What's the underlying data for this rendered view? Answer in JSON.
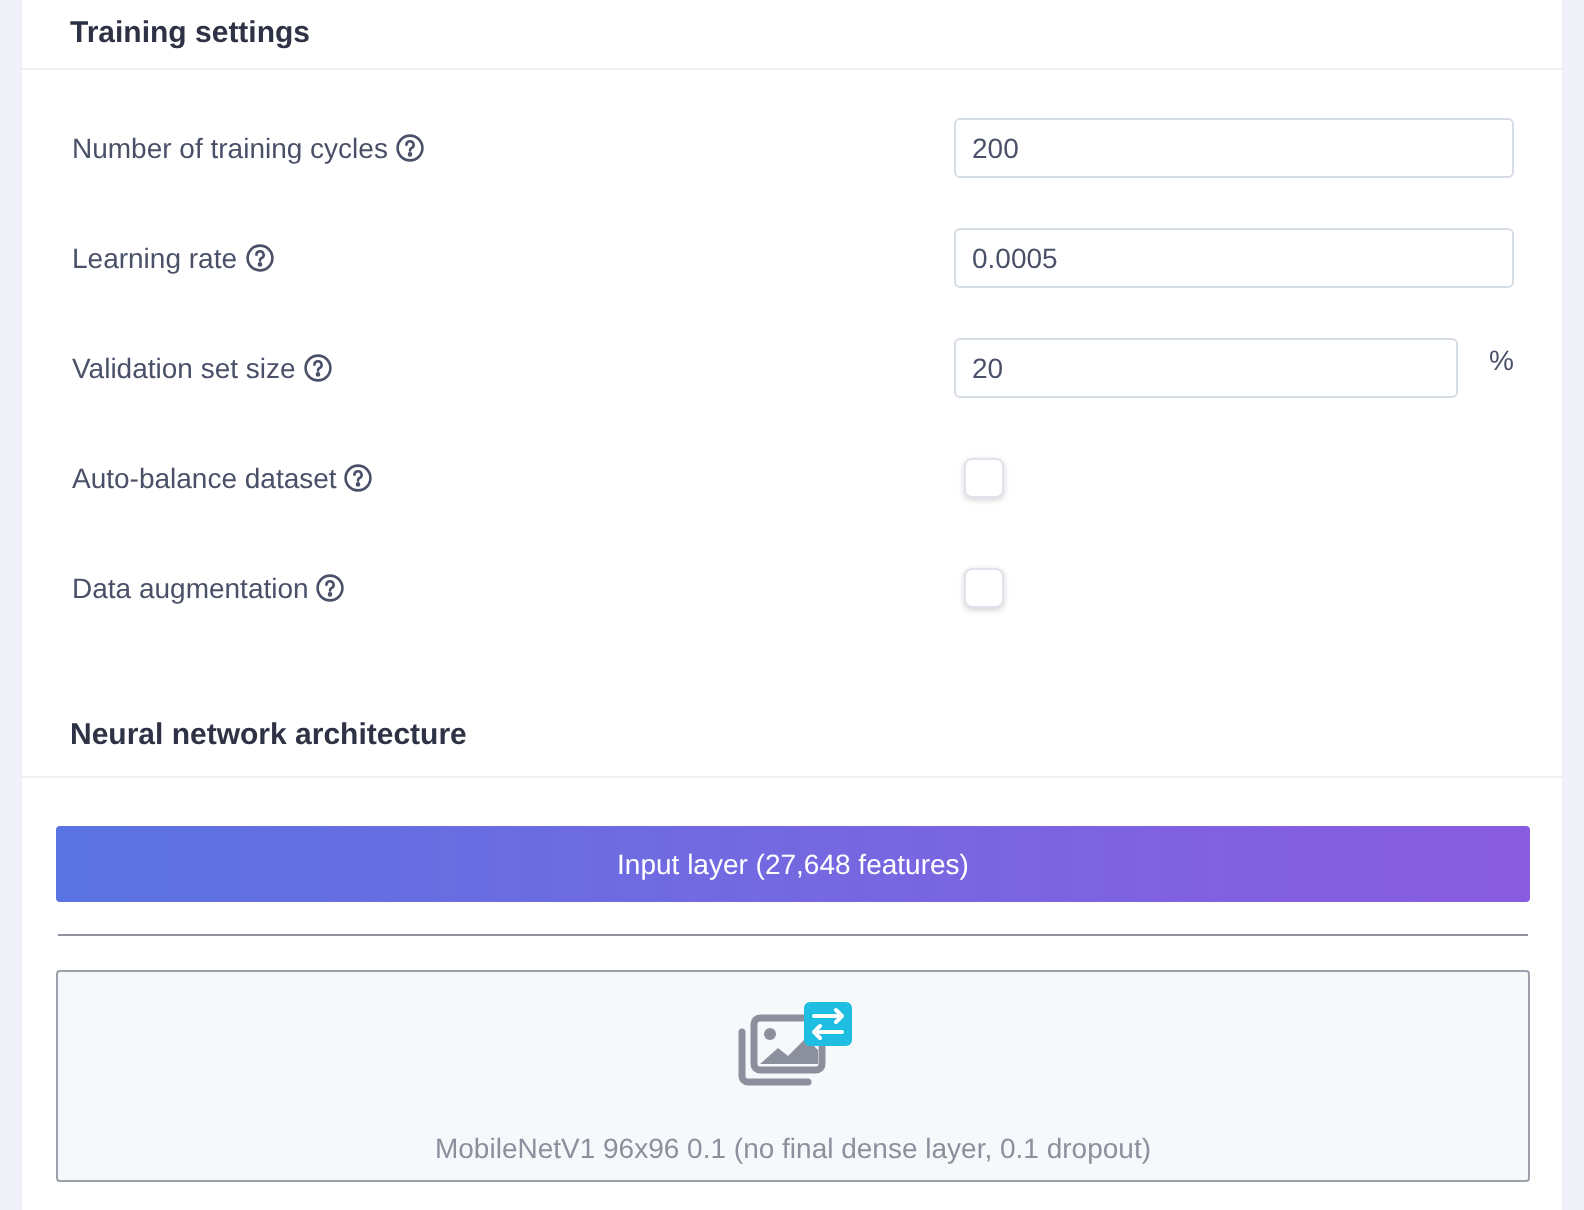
{
  "training_settings": {
    "title": "Training settings",
    "fields": [
      {
        "kind": "number",
        "label": "Number of training cycles",
        "value": "200"
      },
      {
        "kind": "number",
        "label": "Learning rate",
        "value": "0.0005"
      },
      {
        "kind": "number",
        "label": "Validation set size",
        "value": "20",
        "unit": "%"
      },
      {
        "kind": "checkbox",
        "label": "Auto-balance dataset",
        "checked": false
      },
      {
        "kind": "checkbox",
        "label": "Data augmentation",
        "checked": false
      }
    ]
  },
  "architecture": {
    "title": "Neural network architecture",
    "input_layer": "Input layer (27,648 features)",
    "layers": [
      {
        "kind": "transfer",
        "label": "MobileNetV1 96x96 0.1 (no final dense layer, 0.1 dropout)"
      }
    ]
  }
}
